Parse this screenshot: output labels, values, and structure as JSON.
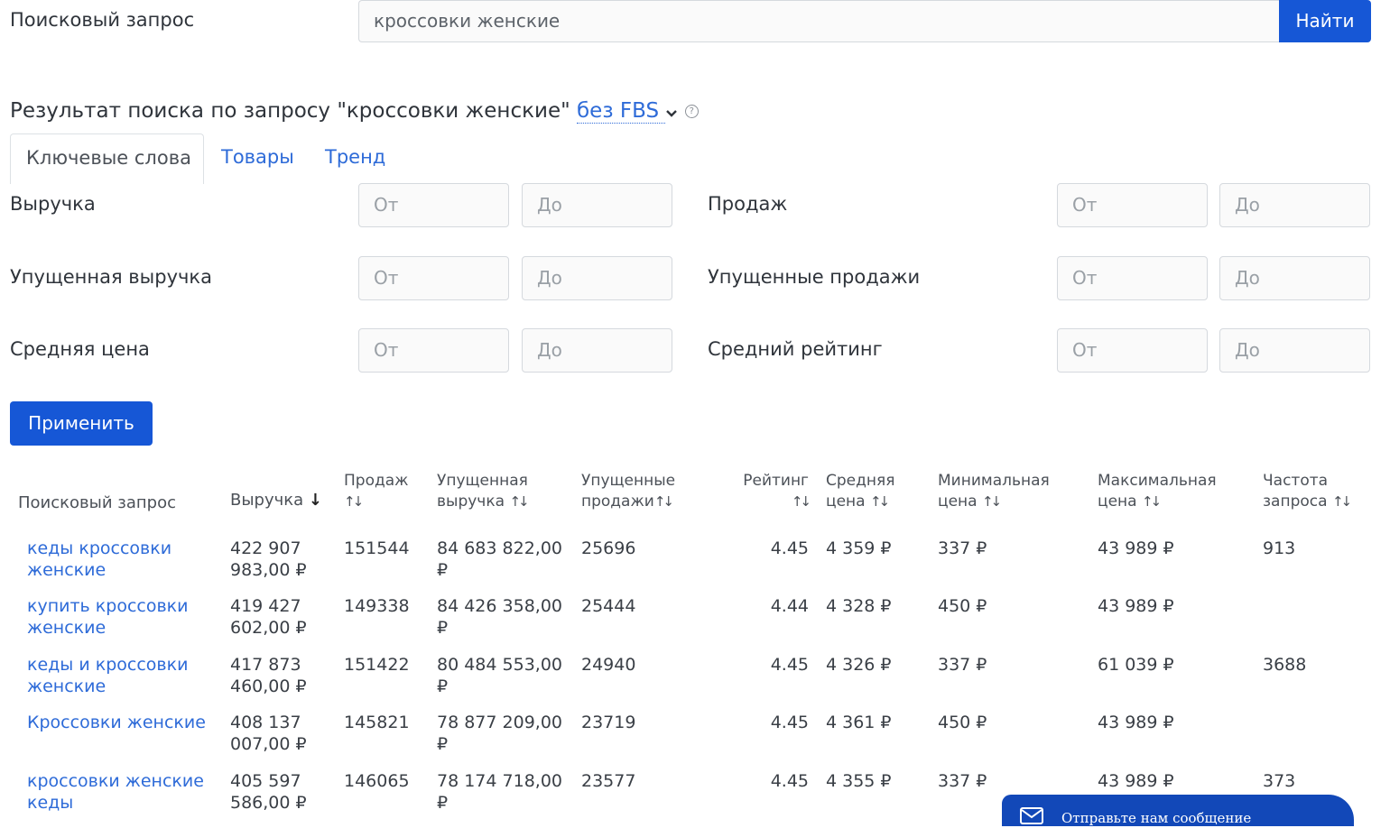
{
  "search": {
    "label": "Поисковый запрос",
    "value": "кроссовки женские",
    "button": "Найти"
  },
  "result": {
    "title": "Результат поиска по запросу \"кроссовки женские\"",
    "mode_link": "без FBS",
    "help": "?"
  },
  "tabs": [
    "Ключевые слова",
    "Товары",
    "Тренд"
  ],
  "filters": {
    "revenue": "Выручка",
    "sales": "Продаж",
    "lost_revenue": "Упущенная выручка",
    "lost_sales": "Упущенные продажи",
    "avg_price": "Средняя цена",
    "avg_rating": "Средний рейтинг",
    "from": "От",
    "to": "До",
    "apply": "Применить"
  },
  "table": {
    "headers": {
      "query": "Поисковый запрос",
      "revenue": "Выручка",
      "sales_1": "Продаж",
      "lost_rev_1": "Упущенная",
      "lost_rev_2": "выручка",
      "lost_sales_1": "Упущенные",
      "lost_sales_2": "продажи",
      "rating": "Рейтинг",
      "avg_price_1": "Средняя",
      "avg_price_2": "цена",
      "min_price_1": "Минимальная",
      "min_price_2": "цена",
      "max_price_1": "Максимальная",
      "max_price_2": "цена",
      "freq_1": "Частота",
      "freq_2": "запроса"
    },
    "rows": [
      {
        "q1": "кеды кроссовки",
        "q2": "женские",
        "rev1": "422 907",
        "rev2": "983,00 ₽",
        "sales": "151544",
        "lrev1": "84 683 822,00",
        "lrev2": "₽",
        "lsales": "25696",
        "rating": "4.45",
        "avg": "4 359 ₽",
        "min": "337 ₽",
        "max": "43 989 ₽",
        "freq": "913"
      },
      {
        "q1": "купить кроссовки",
        "q2": "женские",
        "rev1": "419 427",
        "rev2": "602,00 ₽",
        "sales": "149338",
        "lrev1": "84 426 358,00",
        "lrev2": "₽",
        "lsales": "25444",
        "rating": "4.44",
        "avg": "4 328 ₽",
        "min": "450 ₽",
        "max": "43 989 ₽",
        "freq": ""
      },
      {
        "q1": "кеды и кроссовки",
        "q2": "женские",
        "rev1": "417 873",
        "rev2": "460,00 ₽",
        "sales": "151422",
        "lrev1": "80 484 553,00",
        "lrev2": "₽",
        "lsales": "24940",
        "rating": "4.45",
        "avg": "4 326 ₽",
        "min": "337 ₽",
        "max": "61 039 ₽",
        "freq": "3688"
      },
      {
        "q1": "Кроссовки женские",
        "q2": "",
        "rev1": "408 137",
        "rev2": "007,00 ₽",
        "sales": "145821",
        "lrev1": "78 877 209,00",
        "lrev2": "₽",
        "lsales": "23719",
        "rating": "4.45",
        "avg": "4 361 ₽",
        "min": "450 ₽",
        "max": "43 989 ₽",
        "freq": ""
      },
      {
        "q1": "кроссовки женские",
        "q2": "кеды",
        "rev1": "405 597",
        "rev2": "586,00 ₽",
        "sales": "146065",
        "lrev1": "78 174 718,00",
        "lrev2": "₽",
        "lsales": "23577",
        "rating": "4.45",
        "avg": "4 355 ₽",
        "min": "337 ₽",
        "max": "43 989 ₽",
        "freq": "373"
      }
    ]
  },
  "chat_widget": {
    "label": "Отправьте нам сообщение"
  },
  "colors": {
    "accent": "#1657d6",
    "link": "#2e6bd8"
  }
}
